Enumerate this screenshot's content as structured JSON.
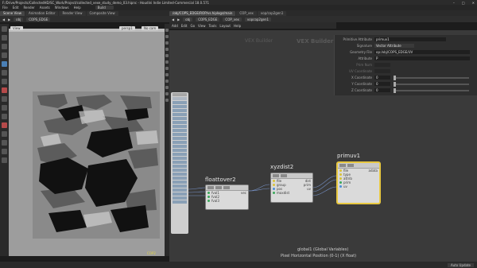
{
  "window": {
    "title": "F:/Drive/Projects/CollectedHD/SC_Work/Project/collected_vexe_study_demo_03.hipnc - Houdini Indie Limited-Commercial 18.0.571"
  },
  "menubar": {
    "items": [
      "File",
      "Edit",
      "Render",
      "Assets",
      "Windows",
      "Help"
    ],
    "desktop": "Build"
  },
  "left_tabs": [
    "Scene View",
    "Animation Editor",
    "Render View",
    "Composite View"
  ],
  "right_tabs": [
    "/obj/COPS_EDGE/ROP/vs.hiplogs/main",
    "COP_vex",
    "vop/cop2gen1"
  ],
  "left_path": {
    "obj": "obj",
    "node": "COPS_EDGE"
  },
  "right_path": {
    "items": [
      "obj",
      "COPS_EDGE",
      "COP_vex",
      "vopcop2gen1"
    ]
  },
  "right_menu": [
    "Add",
    "Edit",
    "Go",
    "View",
    "Tools",
    "Layout",
    "Help"
  ],
  "viewport": {
    "label": "View",
    "badge_left": "1",
    "badge_mid": "persp1",
    "badge_right": "No cam",
    "bottom_label": "COP2"
  },
  "network": {
    "bg_title": "VEX Builder",
    "bg_subtitle": "VEX Builder"
  },
  "params": {
    "node_type": "Primitive Attribute",
    "node_name": "primuv1",
    "rows": [
      {
        "label": "Signature",
        "value": "Vector Attribute"
      },
      {
        "label": "Geometry File",
        "value": "op:/obj/COPS_EDGE/UV"
      },
      {
        "label": "Attribute",
        "value": "P"
      },
      {
        "label": "Prim Num",
        "value": ""
      },
      {
        "label": "UV Coordinate",
        "value": ""
      },
      {
        "label": "X Coordinate",
        "value": "0"
      },
      {
        "label": "Y Coordinate",
        "value": "0"
      },
      {
        "label": "Z Coordinate",
        "value": "0"
      }
    ]
  },
  "nodes": {
    "global": {
      "title": ""
    },
    "floattover": {
      "title": "floattover2",
      "in": [
        "fval1",
        "fval2",
        "fval3"
      ],
      "out": "vec"
    },
    "xyzdist": {
      "title": "xyzdist2",
      "in": [
        "file",
        "group",
        "pos",
        "maxdist"
      ],
      "out": [
        "dist",
        "prim",
        "uv"
      ]
    },
    "primuv": {
      "title": "primuv1",
      "in": [
        "file",
        "type",
        "attrib",
        "prim",
        "uv"
      ],
      "out": "adata"
    }
  },
  "info": {
    "line1": "global1 (Global Variables)",
    "line2": "Pixel Horizontal Position (0-1) (X float)"
  },
  "status": {
    "button": "Auto Update"
  },
  "colors": {
    "port_green": "#3aa85a",
    "port_blue": "#4c8fd6",
    "port_yellow": "#d8c23a",
    "selection": "#e8c840"
  }
}
